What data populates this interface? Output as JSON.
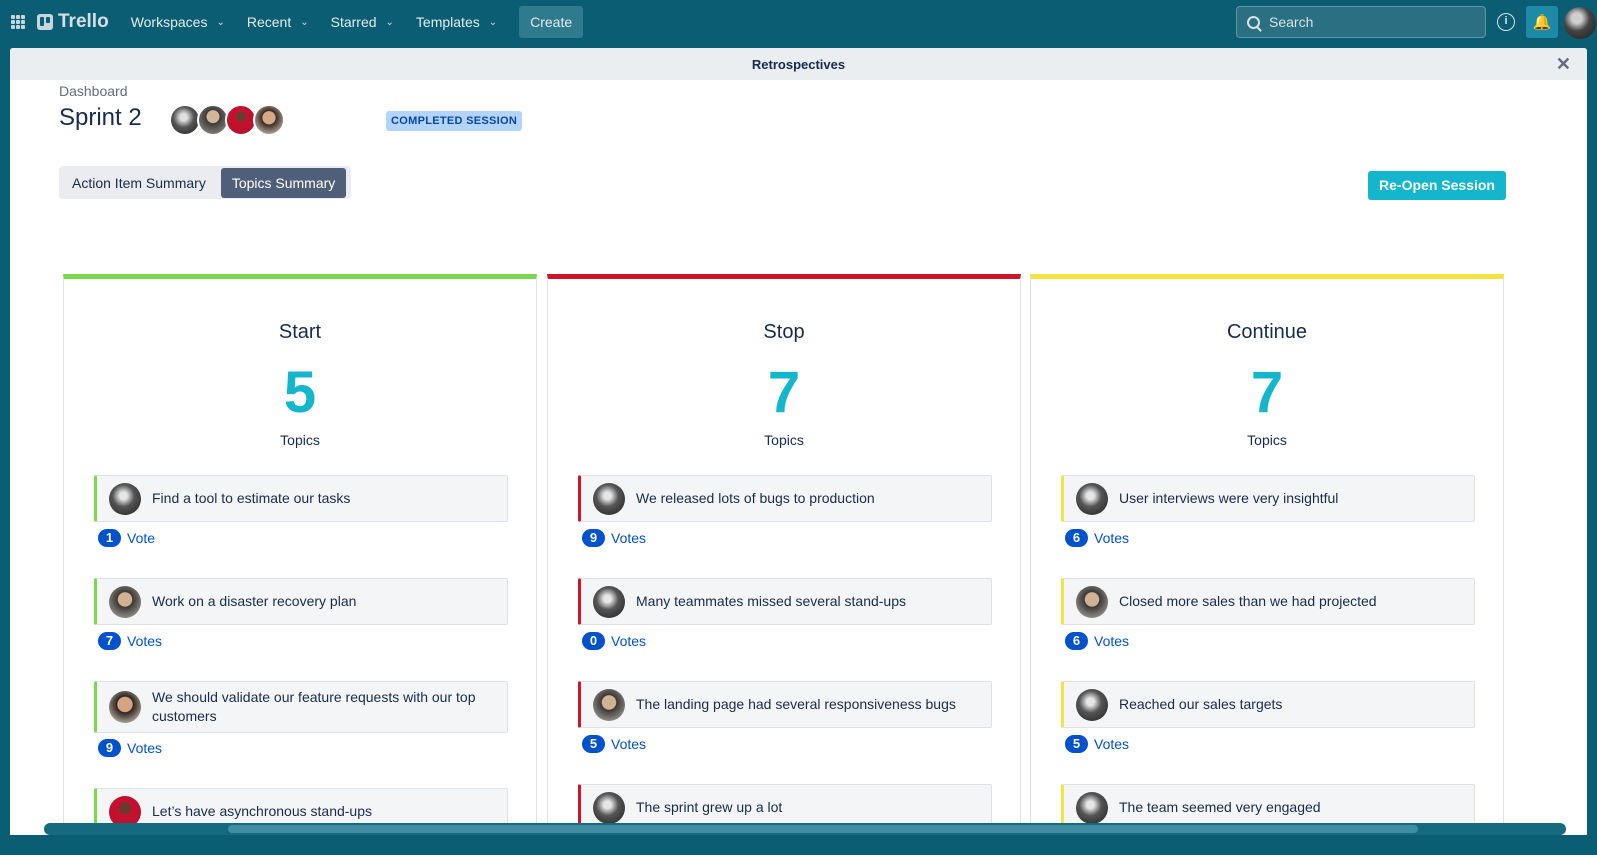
{
  "topbar": {
    "app_name": "Trello",
    "nav": [
      {
        "label": "Workspaces"
      },
      {
        "label": "Recent"
      },
      {
        "label": "Starred"
      },
      {
        "label": "Templates"
      }
    ],
    "create_label": "Create",
    "search_placeholder": "Search",
    "info_glyph": "i",
    "bell_glyph": "🔔"
  },
  "modal": {
    "title": "Retrospectives",
    "close_glyph": "✕",
    "breadcrumb": "Dashboard",
    "session_title": "Sprint 2",
    "status": "COMPLETED SESSION",
    "tabs": [
      {
        "label": "Action Item Summary"
      },
      {
        "label": "Topics Summary"
      }
    ],
    "reopen_label": "Re-Open Session"
  },
  "columns": {
    "start": {
      "title": "Start",
      "count": "5",
      "unit": "Topics",
      "topics": [
        {
          "text": "Find a tool to estimate our tasks",
          "votes": "1",
          "votes_label": "Vote"
        },
        {
          "text": "Work on a disaster recovery plan",
          "votes": "7",
          "votes_label": "Votes"
        },
        {
          "text": "We should validate our feature requests with our top customers",
          "votes": "9",
          "votes_label": "Votes"
        },
        {
          "text": "Let’s have asynchronous stand-ups"
        }
      ]
    },
    "stop": {
      "title": "Stop",
      "count": "7",
      "unit": "Topics",
      "topics": [
        {
          "text": "We released lots of bugs to production",
          "votes": "9",
          "votes_label": "Votes"
        },
        {
          "text": "Many teammates missed several stand-ups",
          "votes": "0",
          "votes_label": "Votes"
        },
        {
          "text": "The landing page had several responsiveness bugs",
          "votes": "5",
          "votes_label": "Votes"
        },
        {
          "text": "The sprint grew up a lot"
        }
      ]
    },
    "continue": {
      "title": "Continue",
      "count": "7",
      "unit": "Topics",
      "topics": [
        {
          "text": "User interviews were very insightful",
          "votes": "6",
          "votes_label": "Votes"
        },
        {
          "text": "Closed more sales than we had projected",
          "votes": "6",
          "votes_label": "Votes"
        },
        {
          "text": "Reached our sales targets",
          "votes": "5",
          "votes_label": "Votes"
        },
        {
          "text": "The team seemed very engaged"
        }
      ]
    }
  },
  "colors": {
    "start": "#7bd74b",
    "stop": "#d0152b",
    "continue": "#f5e341",
    "accent": "#13b6cc",
    "vote": "#0052cc"
  }
}
